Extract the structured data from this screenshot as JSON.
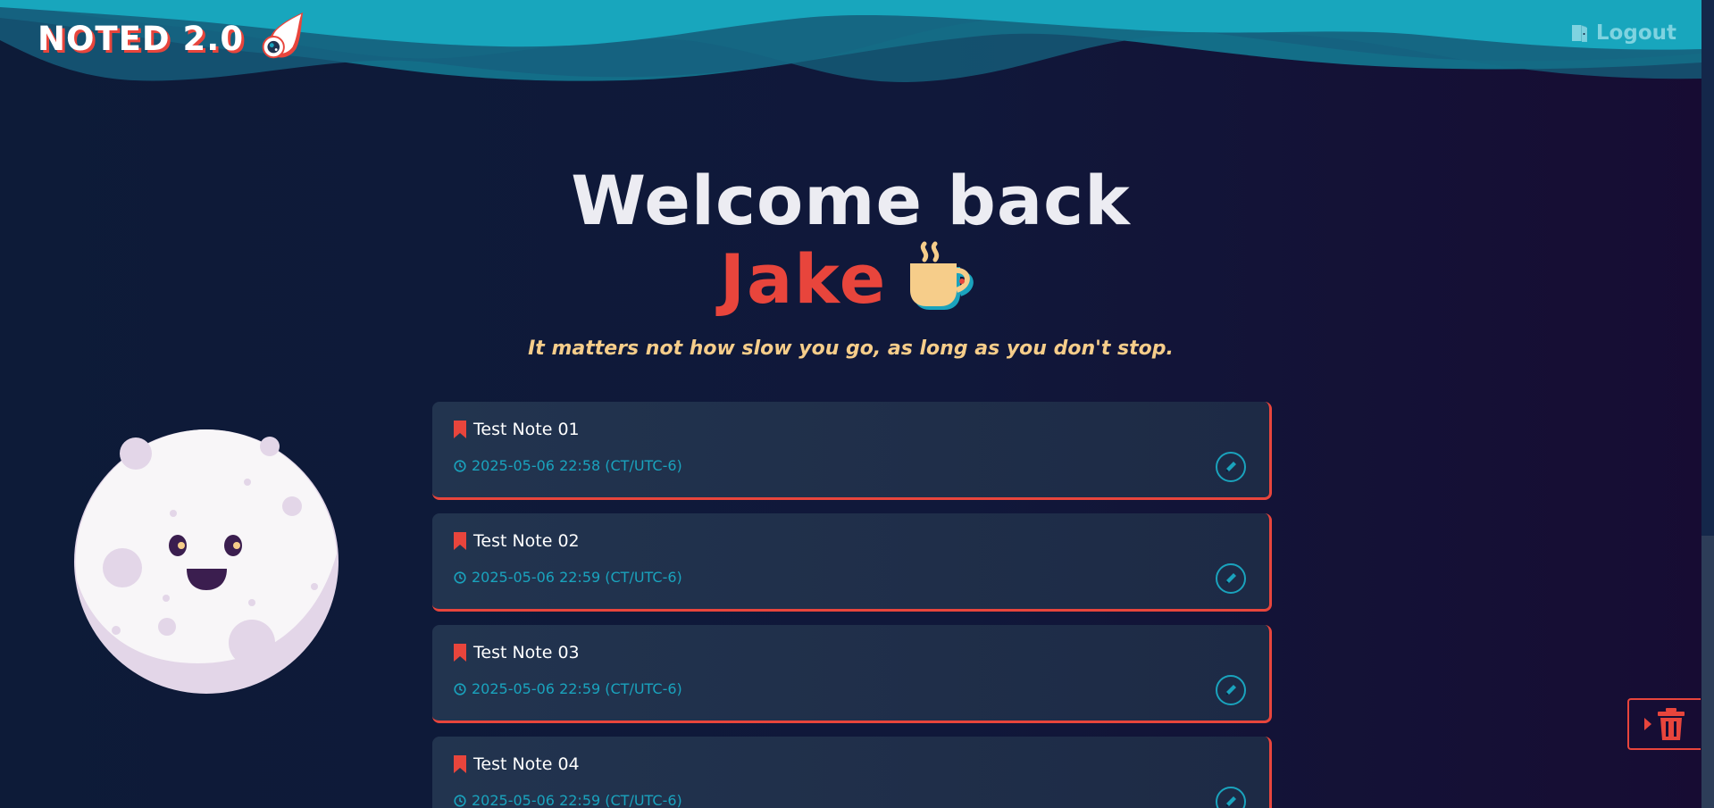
{
  "header": {
    "logo_text": "NOTED 2.0",
    "logo_icon": "comet-icon",
    "logout_label": "Logout",
    "logout_icon": "door-exit-icon"
  },
  "welcome": {
    "greeting": "Welcome back",
    "user_name": "Jake",
    "cup_icon": "coffee-cup-icon",
    "quote": "It matters not how slow you go, as long as you don't stop."
  },
  "moon": {
    "icon": "smiling-moon-illustration"
  },
  "notes": [
    {
      "title": "Test Note 01",
      "date": "2025-05-06 22:58 (CT/UTC-6)"
    },
    {
      "title": "Test Note 02",
      "date": "2025-05-06 22:59 (CT/UTC-6)"
    },
    {
      "title": "Test Note 03",
      "date": "2025-05-06 22:59 (CT/UTC-6)"
    },
    {
      "title": "Test Note 04",
      "date": "2025-05-06 22:59 (CT/UTC-6)"
    }
  ],
  "trash": {
    "icon": "trash-icon",
    "caret_icon": "caret-right-icon"
  },
  "colors": {
    "accent_red": "#e8453c",
    "teal": "#1aa3bd",
    "quote_gold": "#f6cd8a",
    "background_start": "#0d1b38",
    "background_end": "#170c33"
  }
}
